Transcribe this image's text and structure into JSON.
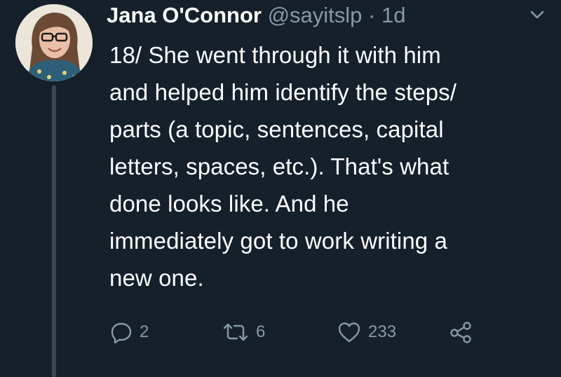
{
  "tweet": {
    "author_name": "Jana O'Connor",
    "handle": "@sayitslp",
    "separator": "·",
    "time": "1d",
    "text": "18/ She went through it with him\nand helped him identify the steps/\nparts (a topic, sentences, capital\nletters, spaces, etc.). That's what\ndone looks like. And he\nimmediately got to work writing a\nnew one.",
    "reply_count": "2",
    "retweet_count": "6",
    "like_count": "233"
  },
  "icons": {
    "caret": "chevron-down-icon",
    "reply": "reply-icon",
    "retweet": "retweet-icon",
    "like": "heart-icon",
    "share": "share-icon"
  },
  "colors": {
    "background": "#15202b",
    "text": "#ffffff",
    "secondary": "#8899a6",
    "thread_line": "#3a4551"
  }
}
